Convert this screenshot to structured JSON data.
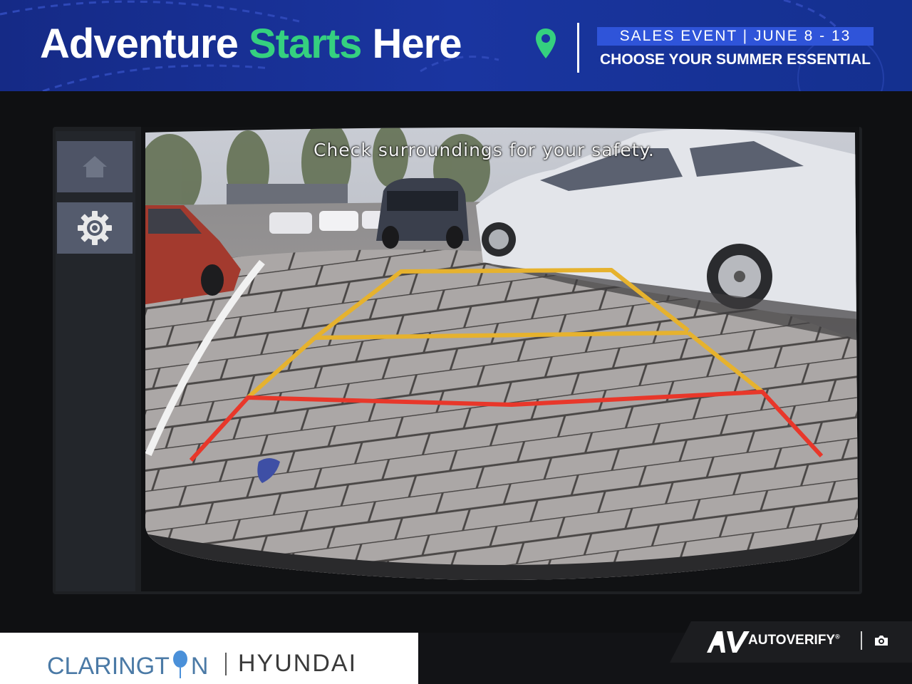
{
  "banner": {
    "headline_part1": "Adventure",
    "headline_part2": "Starts",
    "headline_part3": "Here",
    "event_line": "SALES EVENT | JUNE 8 - 13",
    "tagline": "CHOOSE YOUR SUMMER ESSENTIAL",
    "colors": {
      "background": "#1a35a0",
      "accent_green": "#35d07f",
      "event_box": "#2f54d9"
    }
  },
  "display": {
    "sidebar": {
      "home_icon": "home-icon",
      "settings_icon": "gear-icon"
    },
    "camera": {
      "warning_text": "Check surroundings for your safety.",
      "guide_colors": {
        "far": "#e6b22e",
        "near": "#e8372a"
      }
    }
  },
  "footer": {
    "dealer_name_pre": "CLARINGT",
    "dealer_name_post": "N",
    "dealer_brand": "HYUNDAI",
    "verify_brand": "AUTOVERIFY",
    "verify_mark": "®",
    "camera_icon": "camera-icon"
  }
}
